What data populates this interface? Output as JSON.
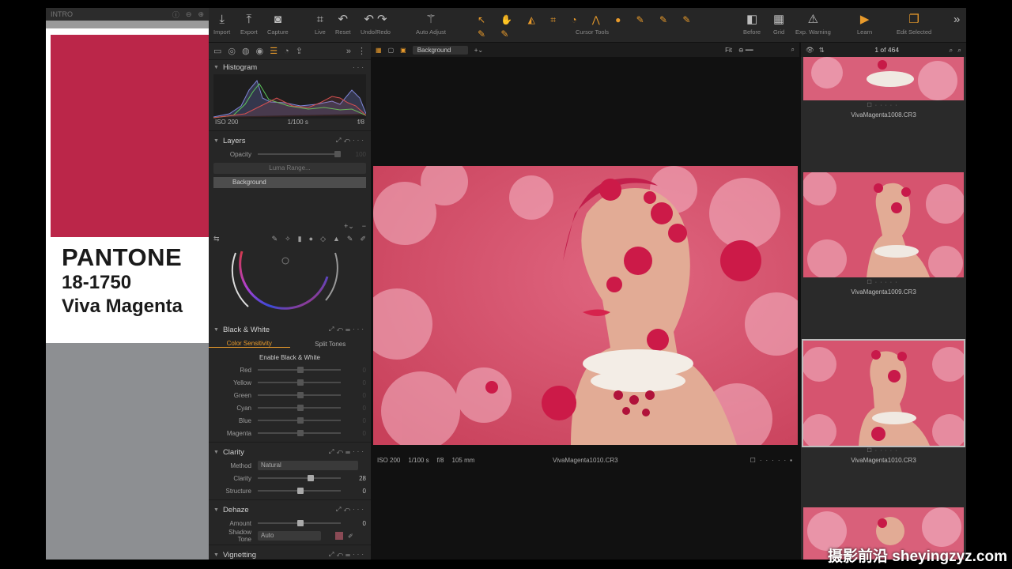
{
  "swatch_window": {
    "title": "INTRO",
    "color": "#bb2649",
    "brand": "PANTONE",
    "code": "18-1750",
    "name": "Viva Magenta"
  },
  "toolbar": {
    "import": "Import",
    "export": "Export",
    "capture": "Capture",
    "live": "Live",
    "reset": "Reset",
    "undo_redo": "Undo/Redo",
    "auto_adjust": "Auto Adjust",
    "cursor_tools": "Cursor Tools",
    "before": "Before",
    "grid": "Grid",
    "exp_warning": "Exp. Warning",
    "learn": "Learn",
    "edit_selected": "Edit Selected"
  },
  "histogram": {
    "title": "Histogram",
    "iso": "ISO 200",
    "shutter": "1/100 s",
    "aperture": "f/8"
  },
  "layers": {
    "title": "Layers",
    "opacity_label": "Opacity",
    "opacity_value": "100",
    "luma_range": "Luma Range...",
    "layer_name": "Background"
  },
  "black_white": {
    "title": "Black & White",
    "tab_color": "Color Sensitivity",
    "tab_split": "Split Tones",
    "enable": "Enable Black & White",
    "channels": [
      {
        "label": "Red",
        "value": "0"
      },
      {
        "label": "Yellow",
        "value": "0"
      },
      {
        "label": "Green",
        "value": "0"
      },
      {
        "label": "Cyan",
        "value": "0"
      },
      {
        "label": "Blue",
        "value": "0"
      },
      {
        "label": "Magenta",
        "value": "0"
      }
    ]
  },
  "clarity": {
    "title": "Clarity",
    "method_label": "Method",
    "method_value": "Natural",
    "clarity_label": "Clarity",
    "clarity_value": "28",
    "structure_label": "Structure",
    "structure_value": "0"
  },
  "dehaze": {
    "title": "Dehaze",
    "amount_label": "Amount",
    "amount_value": "0",
    "shadow_label": "Shadow Tone",
    "shadow_value": "Auto"
  },
  "vignetting": {
    "title": "Vignetting"
  },
  "viewer": {
    "layer_select": "Background",
    "fit": "Fit",
    "iso": "ISO 200",
    "shutter": "1/100 s",
    "aperture": "f/8",
    "focal": "105 mm",
    "filename": "VivaMagenta1010.CR3"
  },
  "browser": {
    "count": "1 of 464",
    "thumbs": [
      {
        "filename": "VivaMagenta1008.CR3"
      },
      {
        "filename": "VivaMagenta1009.CR3"
      },
      {
        "filename": "VivaMagenta1010.CR3"
      }
    ]
  },
  "watermark": "摄影前沿 sheyingzyz.com",
  "colors": {
    "accent": "#e89a2b",
    "magenta": "#bb2649"
  }
}
